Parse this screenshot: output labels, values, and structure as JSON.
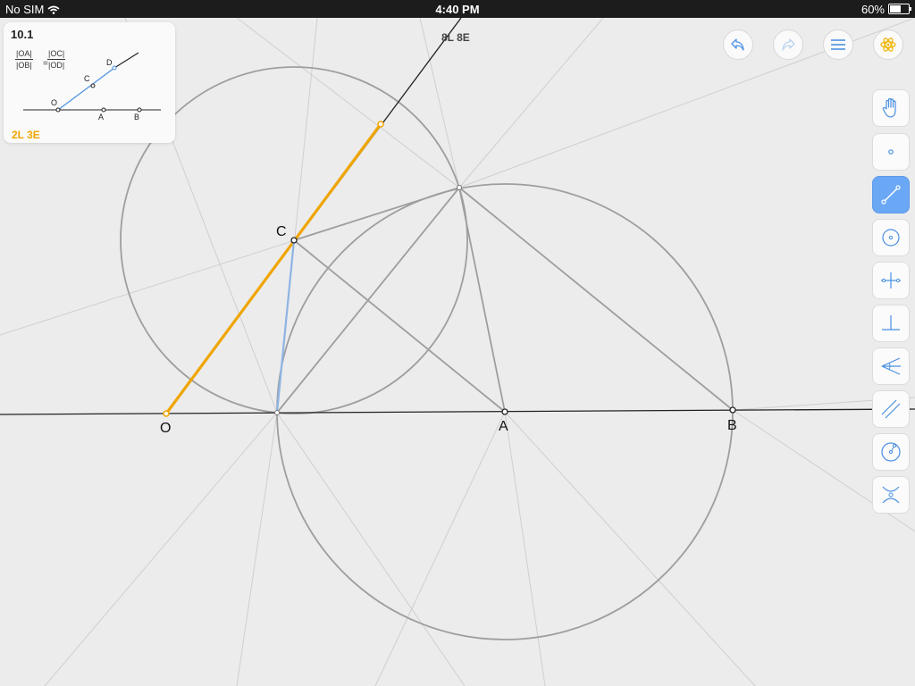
{
  "status_bar": {
    "carrier": "No SIM",
    "time": "4:40 PM",
    "battery": "60%"
  },
  "goal": {
    "level": "10.1",
    "formula": {
      "n1": "|OA|",
      "d1": "|OB|",
      "eq": "=",
      "n2": "|OC|",
      "d2": "|OD|"
    },
    "diagram_labels": {
      "o": "O",
      "a": "A",
      "b": "B",
      "c": "C",
      "d": "D"
    },
    "goal_score": "2L 3E"
  },
  "score": "8L 8E",
  "toolbar_top": [
    "undo-icon",
    "redo-icon",
    "menu-icon",
    "hint-icon"
  ],
  "tools": [
    "hand",
    "point",
    "line",
    "circle",
    "perpendicular-bisector",
    "perpendicular",
    "angle-bisector",
    "parallel",
    "compass",
    "intersect"
  ],
  "active_tool": "line",
  "point_labels": {
    "o": "O",
    "a": "A",
    "b": "B",
    "c": "C"
  },
  "colors": {
    "highlight": "#f0a500",
    "accent": "#4a90e2",
    "construction": "#9e9e9e",
    "guide": "#cfcfcf"
  }
}
